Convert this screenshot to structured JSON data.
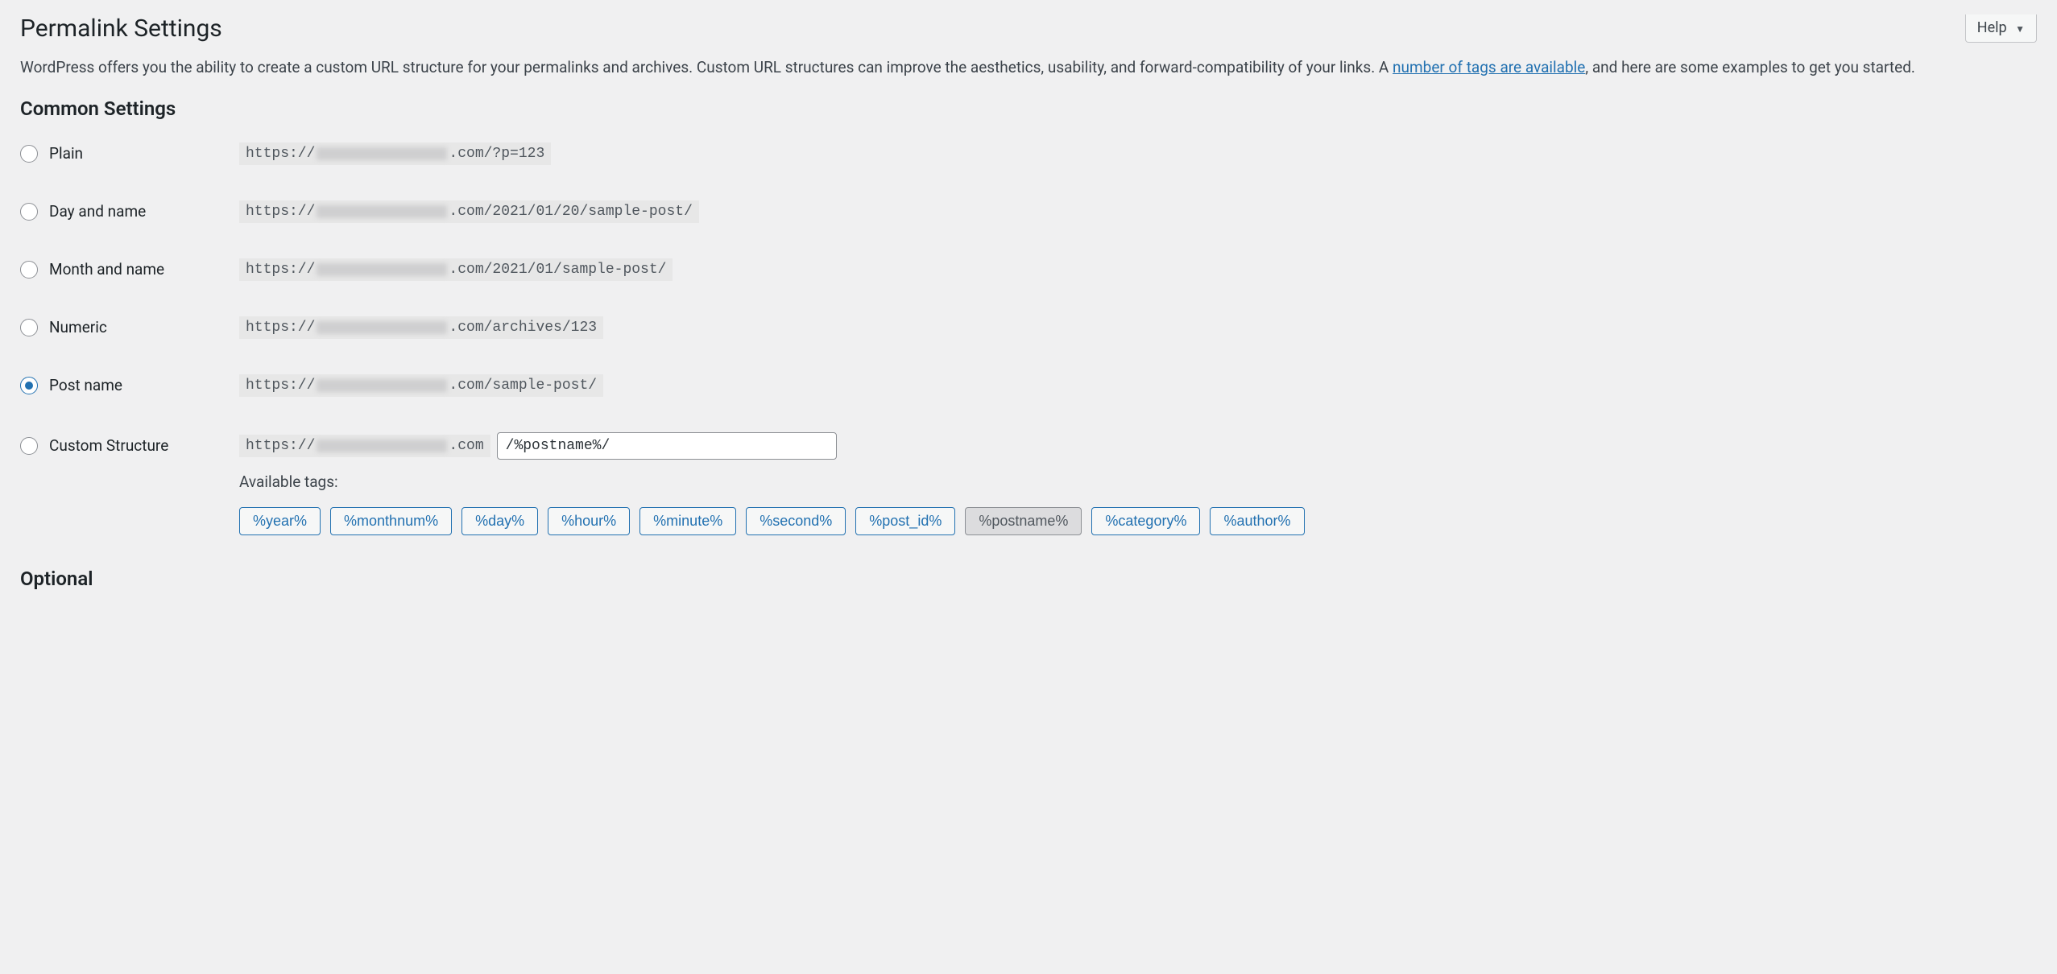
{
  "help": {
    "label": "Help"
  },
  "page": {
    "title": "Permalink Settings",
    "intro_prefix": "WordPress offers you the ability to create a custom URL structure for your permalinks and archives. Custom URL structures can improve the aesthetics, usability, and forward-compatibility of your links. A ",
    "intro_link": "number of tags are available",
    "intro_suffix": ", and here are some examples to get you started."
  },
  "common": {
    "heading": "Common Settings",
    "options": [
      {
        "label": "Plain",
        "checked": false,
        "url_prefix": "https://",
        "url_suffix": ".com/?p=123"
      },
      {
        "label": "Day and name",
        "checked": false,
        "url_prefix": "https://",
        "url_suffix": ".com/2021/01/20/sample-post/"
      },
      {
        "label": "Month and name",
        "checked": false,
        "url_prefix": "https://",
        "url_suffix": ".com/2021/01/sample-post/"
      },
      {
        "label": "Numeric",
        "checked": false,
        "url_prefix": "https://",
        "url_suffix": ".com/archives/123"
      },
      {
        "label": "Post name",
        "checked": true,
        "url_prefix": "https://",
        "url_suffix": ".com/sample-post/"
      }
    ],
    "custom": {
      "label": "Custom Structure",
      "checked": false,
      "base_prefix": "https://",
      "base_suffix": ".com",
      "value": "/%postname%/"
    },
    "available_tags_label": "Available tags:",
    "tags": [
      {
        "label": "%year%",
        "active": false
      },
      {
        "label": "%monthnum%",
        "active": false
      },
      {
        "label": "%day%",
        "active": false
      },
      {
        "label": "%hour%",
        "active": false
      },
      {
        "label": "%minute%",
        "active": false
      },
      {
        "label": "%second%",
        "active": false
      },
      {
        "label": "%post_id%",
        "active": false
      },
      {
        "label": "%postname%",
        "active": true
      },
      {
        "label": "%category%",
        "active": false
      },
      {
        "label": "%author%",
        "active": false
      }
    ]
  },
  "optional": {
    "heading": "Optional"
  }
}
